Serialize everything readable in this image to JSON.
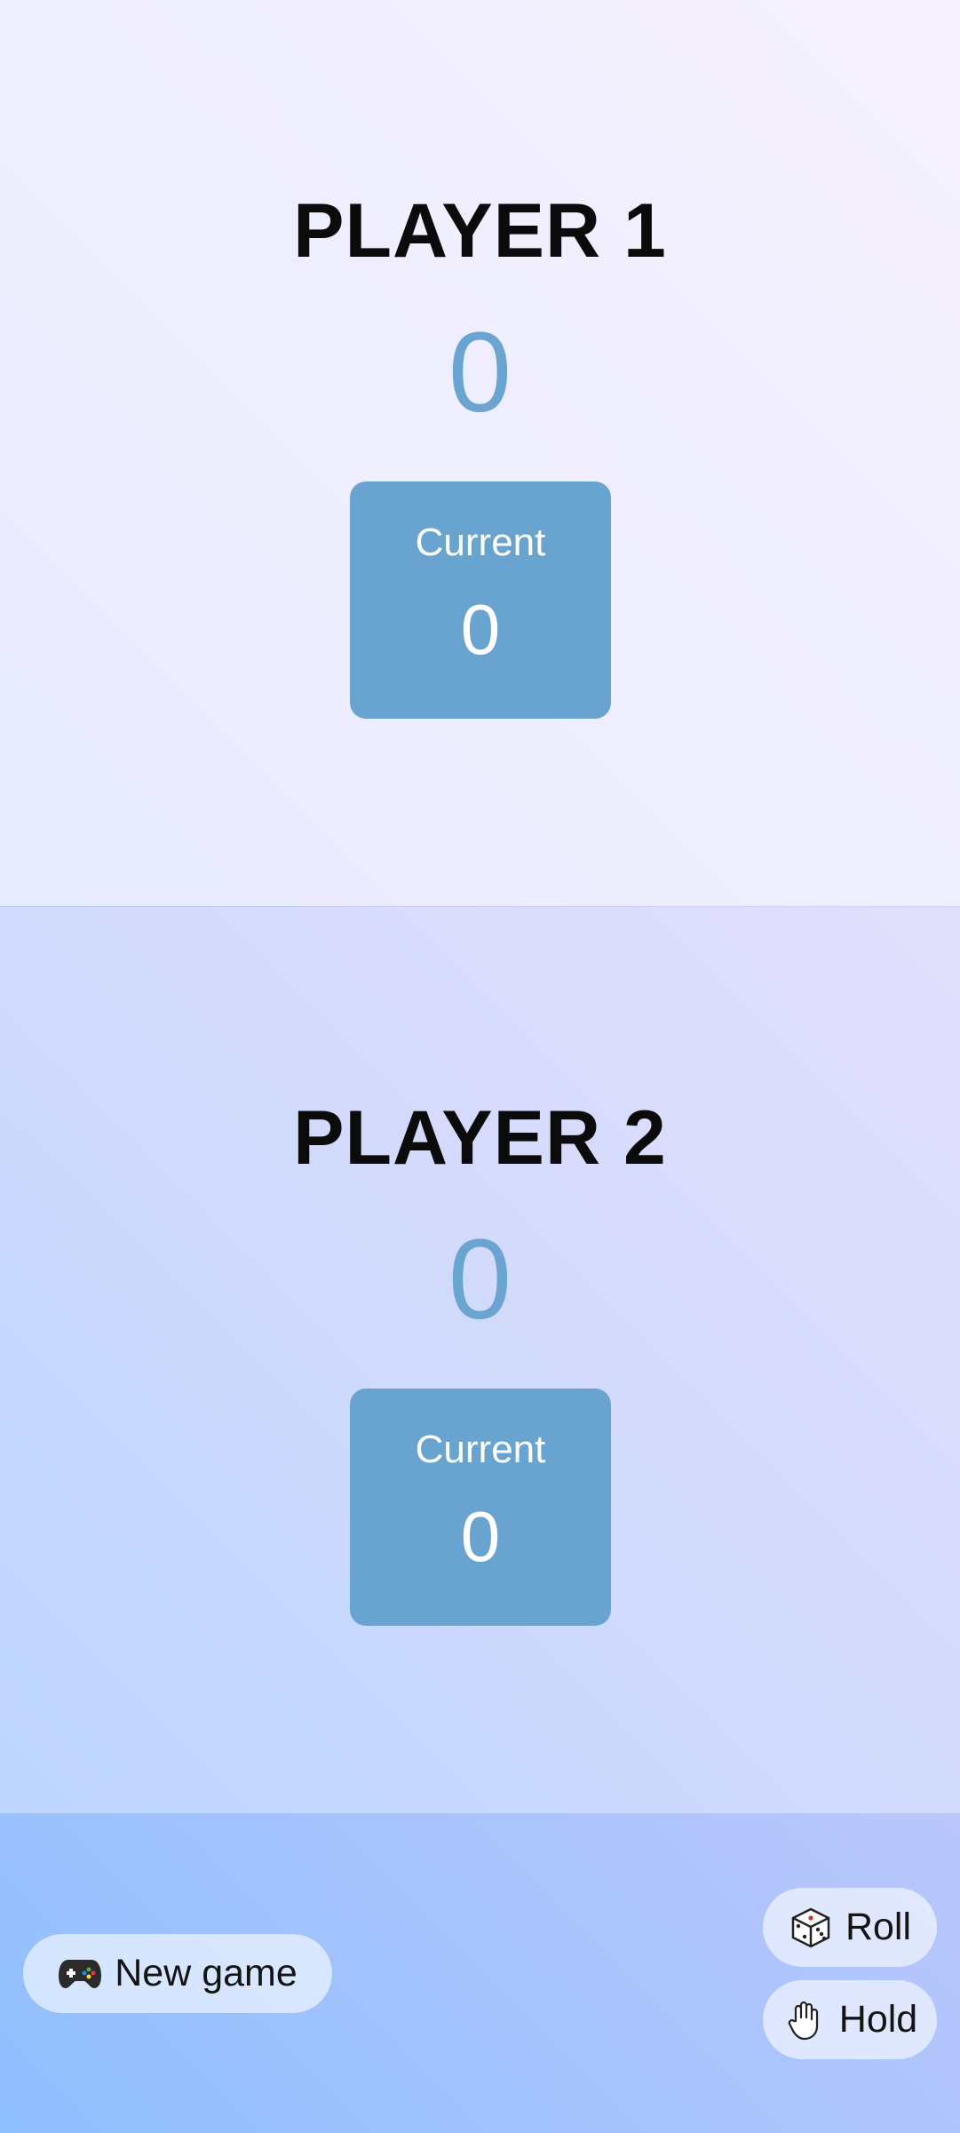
{
  "players": [
    {
      "name": "PLAYER 1",
      "score": "0",
      "current_label": "Current",
      "current_score": "0"
    },
    {
      "name": "PLAYER 2",
      "score": "0",
      "current_label": "Current",
      "current_score": "0"
    }
  ],
  "controls": {
    "new_game": {
      "label": "New game",
      "icon": "gamepad-icon"
    },
    "roll": {
      "label": "Roll",
      "icon": "dice-icon"
    },
    "hold": {
      "label": "Hold",
      "icon": "hand-icon"
    }
  },
  "colors": {
    "score": "#69a5d0",
    "current_box": "#68a4cf"
  }
}
